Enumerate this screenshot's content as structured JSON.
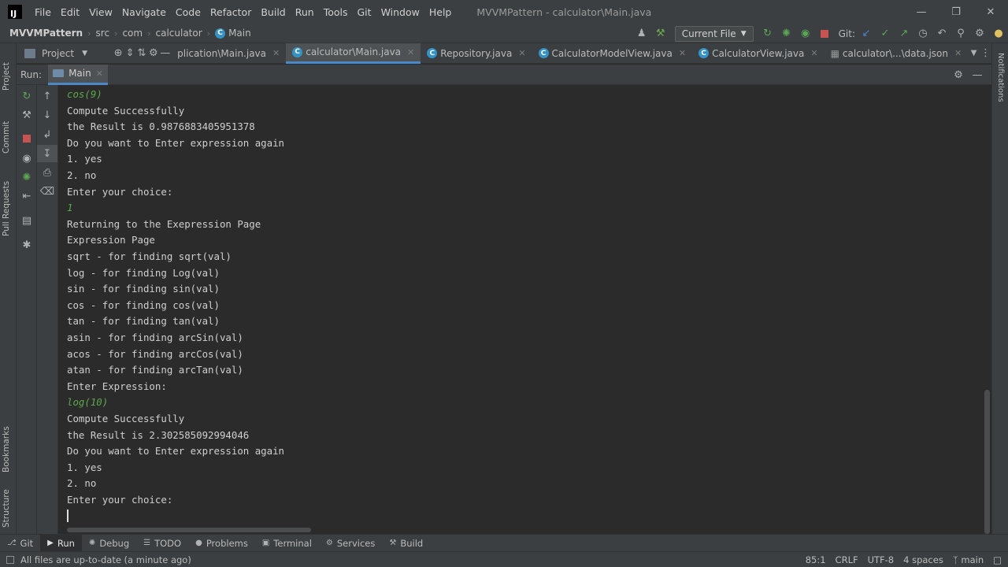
{
  "menubar": {
    "logo": "IJ",
    "items": [
      "File",
      "Edit",
      "View",
      "Navigate",
      "Code",
      "Refactor",
      "Build",
      "Run",
      "Tools",
      "Git",
      "Window",
      "Help"
    ],
    "window_title": "MVVMPattern - calculator\\Main.java"
  },
  "navbar": {
    "crumbs": [
      "MVVMPattern",
      "src",
      "com",
      "calculator",
      "Main"
    ],
    "run_config": "Current File",
    "git_label": "Git:"
  },
  "tabs": {
    "project_label": "Project",
    "files": [
      {
        "label": "plication\\Main.java",
        "active": false
      },
      {
        "label": "calculator\\Main.java",
        "active": true
      },
      {
        "label": "Repository.java",
        "active": false
      },
      {
        "label": "CalculatorModelView.java",
        "active": false
      },
      {
        "label": "CalculatorView.java",
        "active": false
      },
      {
        "label": "calculator\\...\\data.json",
        "active": false
      }
    ]
  },
  "left_strip": [
    "Project",
    "Commit",
    "Pull Requests",
    "Bookmarks",
    "Structure"
  ],
  "right_strip": [
    "Notifications"
  ],
  "run": {
    "label": "Run:",
    "tab": "Main"
  },
  "console": {
    "lines": [
      {
        "text": "cos(9)",
        "input": true
      },
      {
        "text": "Compute Successfully",
        "input": false
      },
      {
        "text": "the Result is 0.9876883405951378",
        "input": false
      },
      {
        "text": "Do you want to Enter expression again",
        "input": false
      },
      {
        "text": "1. yes",
        "input": false
      },
      {
        "text": "2. no",
        "input": false
      },
      {
        "text": "Enter your choice:",
        "input": false
      },
      {
        "text": "1",
        "input": true
      },
      {
        "text": "Returning to the Exepression Page",
        "input": false
      },
      {
        "text": "Expression Page",
        "input": false
      },
      {
        "text": "sqrt - for finding sqrt(val)",
        "input": false
      },
      {
        "text": "log - for finding Log(val)",
        "input": false
      },
      {
        "text": "sin - for finding sin(val)",
        "input": false
      },
      {
        "text": "cos - for finding cos(val)",
        "input": false
      },
      {
        "text": "tan - for finding tan(val)",
        "input": false
      },
      {
        "text": "asin - for finding arcSin(val)",
        "input": false
      },
      {
        "text": "acos - for finding arcCos(val)",
        "input": false
      },
      {
        "text": "atan - for finding arcTan(val)",
        "input": false
      },
      {
        "text": "Enter Expression:",
        "input": false
      },
      {
        "text": "log(10)",
        "input": true
      },
      {
        "text": "Compute Successfully",
        "input": false
      },
      {
        "text": "the Result is 2.302585092994046",
        "input": false
      },
      {
        "text": "Do you want to Enter expression again",
        "input": false
      },
      {
        "text": "1. yes",
        "input": false
      },
      {
        "text": "2. no",
        "input": false
      },
      {
        "text": "Enter your choice:",
        "input": false
      }
    ]
  },
  "bottombar": {
    "items": [
      {
        "label": "Git",
        "icon": "git-icon",
        "active": false
      },
      {
        "label": "Run",
        "icon": "run-icon",
        "active": true
      },
      {
        "label": "Debug",
        "icon": "debug-icon",
        "active": false
      },
      {
        "label": "TODO",
        "icon": "todo-icon",
        "active": false
      },
      {
        "label": "Problems",
        "icon": "problems-icon",
        "active": false
      },
      {
        "label": "Terminal",
        "icon": "terminal-icon",
        "active": false
      },
      {
        "label": "Services",
        "icon": "services-icon",
        "active": false
      },
      {
        "label": "Build",
        "icon": "build-icon",
        "active": false
      }
    ]
  },
  "statusbar": {
    "message": "All files are up-to-date (a minute ago)",
    "position": "85:1",
    "line_separator": "CRLF",
    "encoding": "UTF-8",
    "indent": "4 spaces",
    "branch": "main"
  },
  "colors": {
    "background": "#2b2b2b",
    "panel": "#3c3f41",
    "accent": "#4a88c7",
    "input_text": "#5ba84a"
  }
}
